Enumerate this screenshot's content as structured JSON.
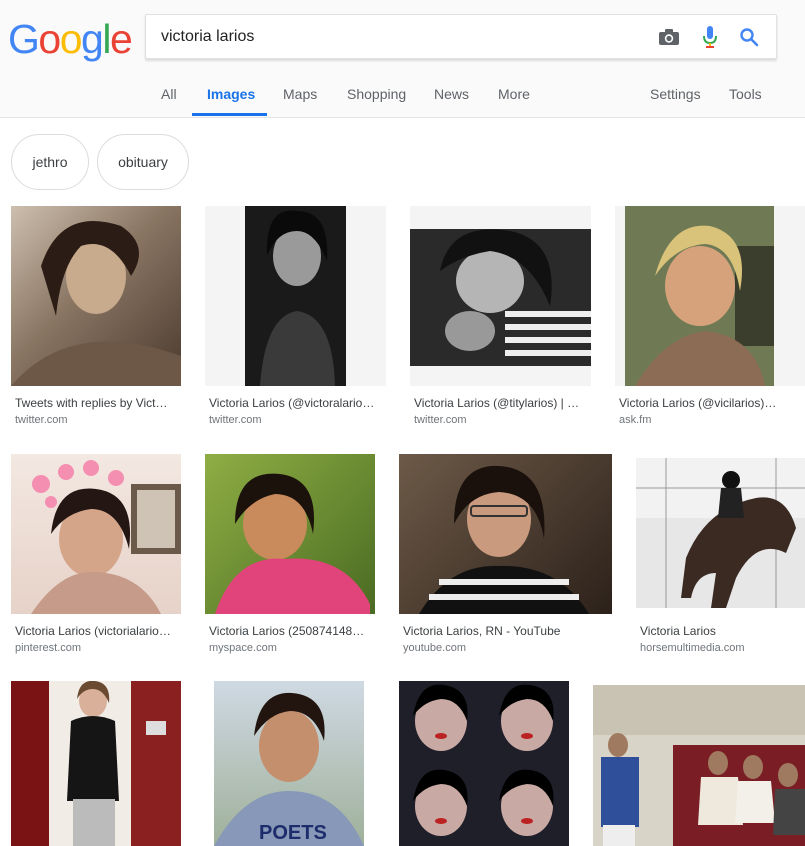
{
  "logo": {
    "letters": [
      "G",
      "o",
      "o",
      "g",
      "l",
      "e"
    ],
    "colors": [
      "#4285f4",
      "#ea4335",
      "#fbbc05",
      "#4285f4",
      "#34a853",
      "#ea4335"
    ]
  },
  "search": {
    "query": "victoria larios"
  },
  "icons": {
    "camera": "camera-icon",
    "mic": "microphone-icon",
    "search": "search-icon"
  },
  "tabs": [
    {
      "label": "All"
    },
    {
      "label": "Images",
      "active": true
    },
    {
      "label": "Maps"
    },
    {
      "label": "Shopping"
    },
    {
      "label": "News"
    },
    {
      "label": "More"
    },
    {
      "label": "Settings"
    },
    {
      "label": "Tools"
    }
  ],
  "chips": [
    {
      "label": "jethro"
    },
    {
      "label": "obituary"
    }
  ],
  "results": [
    {
      "title": "Tweets with replies by Vict…",
      "source": "twitter.com"
    },
    {
      "title": "Victoria Larios (@victoralario…",
      "source": "twitter.com"
    },
    {
      "title": "Victoria Larios (@titylarios) | …",
      "source": "twitter.com"
    },
    {
      "title": "Victoria Larios (@vicilarios)…",
      "source": "ask.fm"
    },
    {
      "title": "Victoria Larios (victorialario…",
      "source": "pinterest.com"
    },
    {
      "title": "Victoria Larios (250874148…",
      "source": "myspace.com"
    },
    {
      "title": "Victoria Larios, RN - YouTube",
      "source": "youtube.com"
    },
    {
      "title": "Victoria Larios",
      "source": "horsemultimedia.com"
    },
    {
      "title": "",
      "source": ""
    },
    {
      "title": "",
      "source": ""
    },
    {
      "title": "",
      "source": ""
    },
    {
      "title": "",
      "source": ""
    }
  ],
  "colors": {
    "accent": "#1a73e8",
    "header_bg": "#fafafa"
  }
}
